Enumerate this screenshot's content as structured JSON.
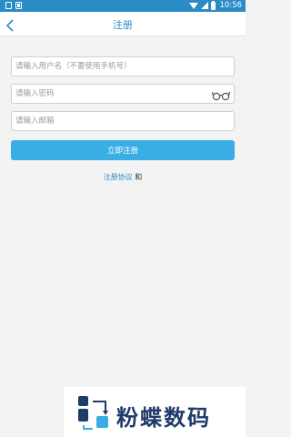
{
  "status_bar": {
    "time": "10:56"
  },
  "header": {
    "title": "注册"
  },
  "form": {
    "username_placeholder": "请输入用户名（不要使用手机号）",
    "password_placeholder": "请输入密码",
    "email_placeholder": "请输入邮箱",
    "submit_label": "立即注册"
  },
  "agreement": {
    "link_text": "注册协议",
    "and_text": "和"
  },
  "watermark": {
    "text": "粉蝶数码"
  },
  "colors": {
    "accent": "#2a8cc7",
    "button": "#3aaee4",
    "background": "#f3f3f3"
  }
}
